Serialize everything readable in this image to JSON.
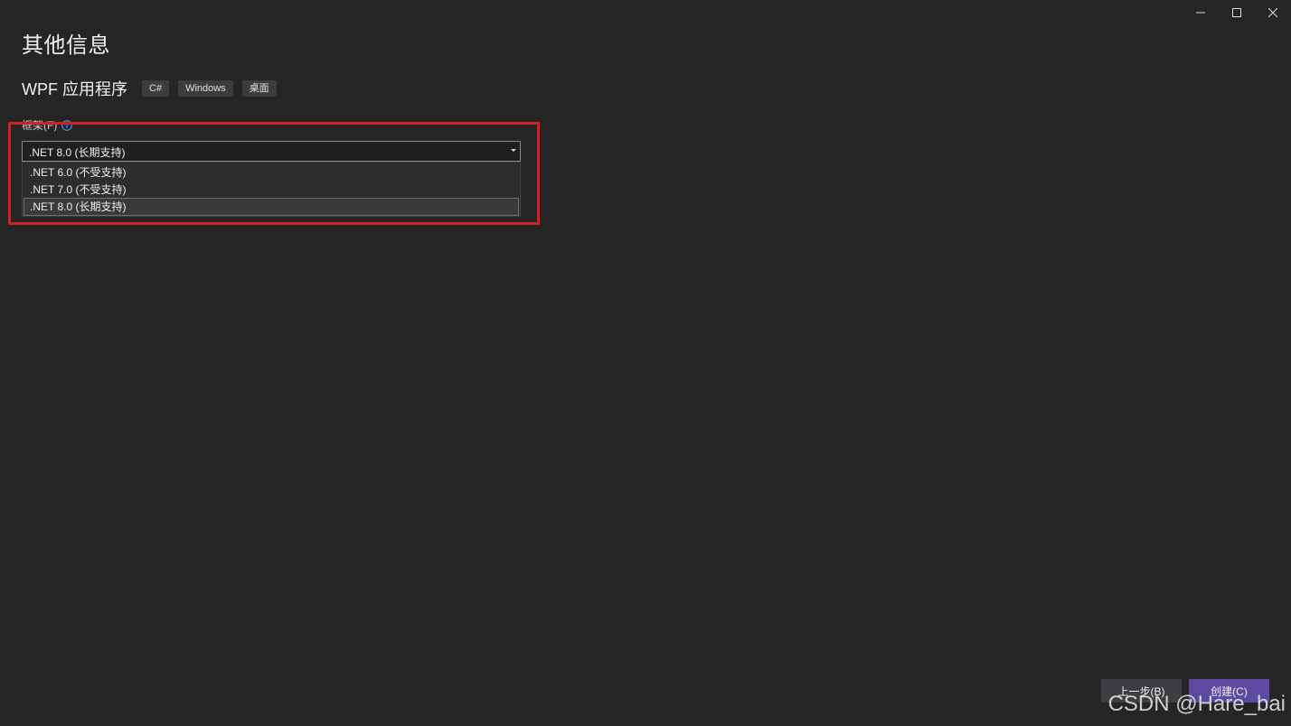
{
  "window": {
    "controls": {
      "minimize_icon": "minimize-icon",
      "maximize_icon": "maximize-icon",
      "close_icon": "close-icon"
    }
  },
  "page": {
    "title": "其他信息"
  },
  "template": {
    "name": "WPF 应用程序",
    "tags": [
      "C#",
      "Windows",
      "桌面"
    ]
  },
  "framework": {
    "label": "框架(F)",
    "info_icon": "info-icon",
    "selected_value": ".NET 8.0 (长期支持)",
    "options": [
      ".NET 6.0 (不受支持)",
      ".NET 7.0 (不受支持)",
      ".NET 8.0 (长期支持)"
    ],
    "selected_index": 2
  },
  "annotation": {
    "highlight_color": "#d42020"
  },
  "footer": {
    "back_label": "上一步(B)",
    "create_label": "创建(C)"
  },
  "watermark": {
    "text": "CSDN @Hare_bai"
  },
  "colors": {
    "background": "#252526",
    "accent": "#5b4aa0",
    "info_blue": "#3794ff"
  }
}
